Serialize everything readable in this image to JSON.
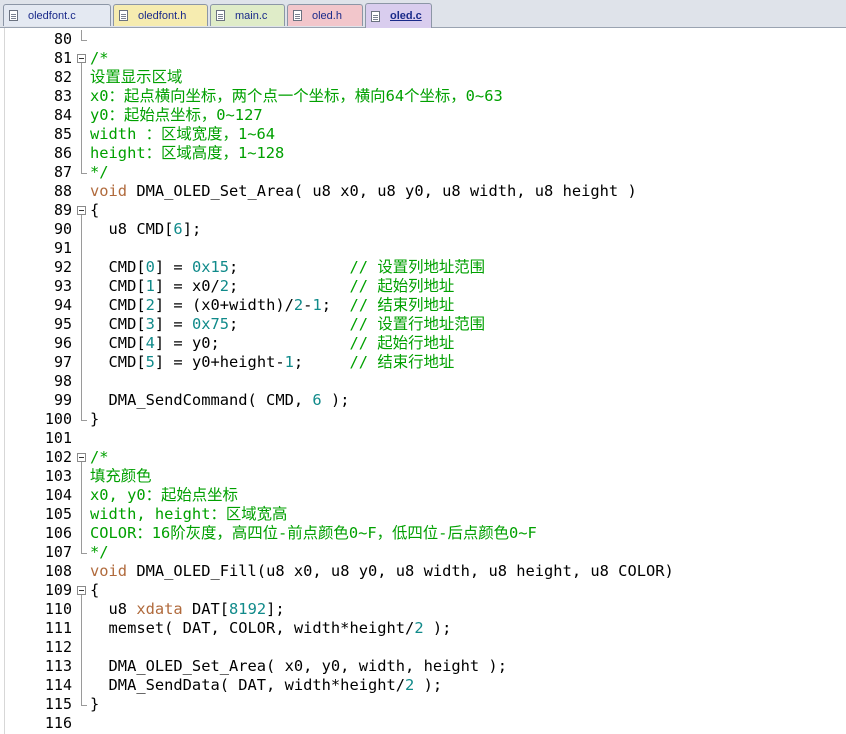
{
  "tabs": [
    {
      "label": "oledfont.c",
      "color": "#e4e9f2",
      "active": false
    },
    {
      "label": "oledfont.h",
      "color": "#f6ecb0",
      "active": false
    },
    {
      "label": "main.c",
      "color": "#dfecc8",
      "active": false
    },
    {
      "label": "oled.h",
      "color": "#f2c6cb",
      "active": false
    },
    {
      "label": "oled.c",
      "color": "#d9cdee",
      "active": true
    }
  ],
  "colors": {
    "comment": "#00a000",
    "keyword": "#b06a3c",
    "number": "#108a8a",
    "text": "#000000"
  },
  "lines": [
    {
      "n": "80",
      "fold": "end",
      "segs": []
    },
    {
      "n": "81",
      "fold": "open",
      "segs": [
        [
          "/*",
          "c"
        ]
      ]
    },
    {
      "n": "82",
      "fold": "line",
      "segs": [
        [
          "设置显示区域",
          "c"
        ]
      ]
    },
    {
      "n": "83",
      "fold": "line",
      "segs": [
        [
          "x0：起点横向坐标，两个点一个坐标，横向64个坐标，0~63",
          "c"
        ]
      ]
    },
    {
      "n": "84",
      "fold": "line",
      "segs": [
        [
          "y0：起始点坐标，0~127",
          "c"
        ]
      ]
    },
    {
      "n": "85",
      "fold": "line",
      "segs": [
        [
          "width ：区域宽度，1~64",
          "c"
        ]
      ]
    },
    {
      "n": "86",
      "fold": "line",
      "segs": [
        [
          "height：区域高度，1~128",
          "c"
        ]
      ]
    },
    {
      "n": "87",
      "fold": "end",
      "segs": [
        [
          "*/",
          "c"
        ]
      ]
    },
    {
      "n": "88",
      "fold": "",
      "segs": [
        [
          "void",
          "k"
        ],
        [
          " DMA_OLED_Set_Area( u8 x0, u8 y0, u8 width, u8 height )",
          ""
        ]
      ]
    },
    {
      "n": "89",
      "fold": "open",
      "segs": [
        [
          "{",
          ""
        ]
      ]
    },
    {
      "n": "90",
      "fold": "line",
      "segs": [
        [
          "  u8 CMD[",
          ""
        ],
        [
          "6",
          "n"
        ],
        [
          "];",
          ""
        ]
      ]
    },
    {
      "n": "91",
      "fold": "line",
      "segs": []
    },
    {
      "n": "92",
      "fold": "line",
      "segs": [
        [
          "  CMD[",
          ""
        ],
        [
          "0",
          "n"
        ],
        [
          "] = ",
          ""
        ],
        [
          "0x15",
          "n"
        ],
        [
          ";            ",
          ""
        ],
        [
          "// 设置列地址范围",
          "c"
        ]
      ]
    },
    {
      "n": "93",
      "fold": "line",
      "segs": [
        [
          "  CMD[",
          ""
        ],
        [
          "1",
          "n"
        ],
        [
          "] = x0/",
          ""
        ],
        [
          "2",
          "n"
        ],
        [
          ";            ",
          ""
        ],
        [
          "// 起始列地址",
          "c"
        ]
      ]
    },
    {
      "n": "94",
      "fold": "line",
      "segs": [
        [
          "  CMD[",
          ""
        ],
        [
          "2",
          "n"
        ],
        [
          "] = (x0+width)/",
          ""
        ],
        [
          "2",
          "n"
        ],
        [
          "-",
          ""
        ],
        [
          "1",
          "n"
        ],
        [
          ";  ",
          ""
        ],
        [
          "// 结束列地址",
          "c"
        ]
      ]
    },
    {
      "n": "95",
      "fold": "line",
      "segs": [
        [
          "  CMD[",
          ""
        ],
        [
          "3",
          "n"
        ],
        [
          "] = ",
          ""
        ],
        [
          "0x75",
          "n"
        ],
        [
          ";            ",
          ""
        ],
        [
          "// 设置行地址范围",
          "c"
        ]
      ]
    },
    {
      "n": "96",
      "fold": "line",
      "segs": [
        [
          "  CMD[",
          ""
        ],
        [
          "4",
          "n"
        ],
        [
          "] = y0;              ",
          ""
        ],
        [
          "// 起始行地址",
          "c"
        ]
      ]
    },
    {
      "n": "97",
      "fold": "line",
      "segs": [
        [
          "  CMD[",
          ""
        ],
        [
          "5",
          "n"
        ],
        [
          "] = y0+height-",
          ""
        ],
        [
          "1",
          "n"
        ],
        [
          ";     ",
          ""
        ],
        [
          "// 结束行地址",
          "c"
        ]
      ]
    },
    {
      "n": "98",
      "fold": "line",
      "segs": []
    },
    {
      "n": "99",
      "fold": "line",
      "segs": [
        [
          "  DMA_SendCommand( CMD, ",
          ""
        ],
        [
          "6",
          "n"
        ],
        [
          " );",
          ""
        ]
      ]
    },
    {
      "n": "100",
      "fold": "end",
      "segs": [
        [
          "}",
          ""
        ]
      ]
    },
    {
      "n": "101",
      "fold": "",
      "segs": []
    },
    {
      "n": "102",
      "fold": "open",
      "segs": [
        [
          "/*",
          "c"
        ]
      ]
    },
    {
      "n": "103",
      "fold": "line",
      "segs": [
        [
          "填充颜色",
          "c"
        ]
      ]
    },
    {
      "n": "104",
      "fold": "line",
      "segs": [
        [
          "x0, y0：起始点坐标",
          "c"
        ]
      ]
    },
    {
      "n": "105",
      "fold": "line",
      "segs": [
        [
          "width, height：区域宽高",
          "c"
        ]
      ]
    },
    {
      "n": "106",
      "fold": "line",
      "segs": [
        [
          "COLOR：16阶灰度，高四位-前点颜色0~F，低四位-后点颜色0~F",
          "c"
        ]
      ]
    },
    {
      "n": "107",
      "fold": "end",
      "segs": [
        [
          "*/",
          "c"
        ]
      ]
    },
    {
      "n": "108",
      "fold": "",
      "segs": [
        [
          "void",
          "k"
        ],
        [
          " DMA_OLED_Fill(u8 x0, u8 y0, u8 width, u8 height, u8 COLOR)",
          ""
        ]
      ]
    },
    {
      "n": "109",
      "fold": "open",
      "segs": [
        [
          "{",
          ""
        ]
      ]
    },
    {
      "n": "110",
      "fold": "line",
      "segs": [
        [
          "  u8 ",
          ""
        ],
        [
          "xdata",
          "k"
        ],
        [
          " DAT[",
          ""
        ],
        [
          "8192",
          "n"
        ],
        [
          "];",
          ""
        ]
      ]
    },
    {
      "n": "111",
      "fold": "line",
      "segs": [
        [
          "  memset( DAT, COLOR, width*height/",
          ""
        ],
        [
          "2",
          "n"
        ],
        [
          " );",
          ""
        ]
      ]
    },
    {
      "n": "112",
      "fold": "line",
      "segs": []
    },
    {
      "n": "113",
      "fold": "line",
      "segs": [
        [
          "  DMA_OLED_Set_Area( x0, y0, width, height );",
          ""
        ]
      ]
    },
    {
      "n": "114",
      "fold": "line",
      "segs": [
        [
          "  DMA_SendData( DAT, width*height/",
          ""
        ],
        [
          "2",
          "n"
        ],
        [
          " );",
          ""
        ]
      ]
    },
    {
      "n": "115",
      "fold": "end",
      "segs": [
        [
          "}",
          ""
        ]
      ]
    },
    {
      "n": "116",
      "fold": "",
      "segs": []
    }
  ]
}
